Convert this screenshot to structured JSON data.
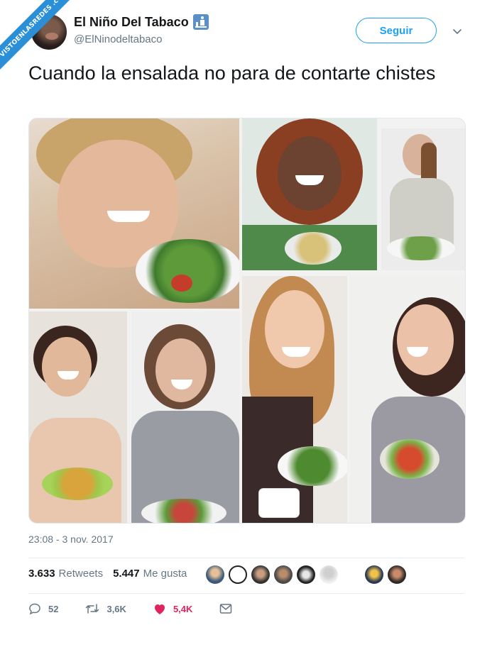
{
  "watermark": {
    "text": "VISTOENLASREDES .com"
  },
  "tweet": {
    "author": {
      "display_name": "El Niño Del Tabaco",
      "handle": "@ElNinodeltabaco"
    },
    "follow_label": "Seguir",
    "text": "Cuando la ensalada no para de contarte chistes",
    "timestamp": "23:08 - 3 nov. 2017",
    "stats": {
      "retweets_count": "3.633",
      "retweets_label": "Retweets",
      "likes_count": "5.447",
      "likes_label": "Me gusta"
    },
    "actions": {
      "reply_count": "52",
      "retweet_count": "3,6K",
      "like_count": "5,4K"
    }
  },
  "colors": {
    "accent": "#1da1f2",
    "like": "#e0245e",
    "secondary_text": "#657786",
    "watermark": "#2a8fd6"
  },
  "icons": [
    "chevron-down-icon",
    "reply-icon",
    "retweet-icon",
    "heart-icon",
    "message-icon"
  ]
}
